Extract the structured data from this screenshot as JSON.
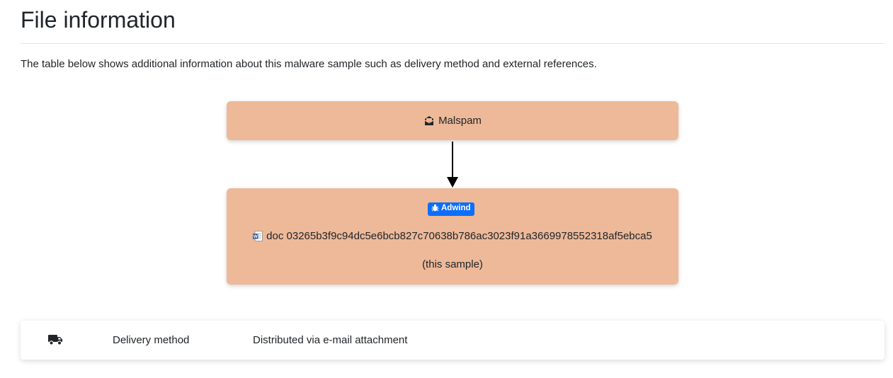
{
  "header": {
    "title": "File information",
    "intro": "The table below shows additional information about this malware sample such as delivery method and external references."
  },
  "flow": {
    "source": {
      "icon": "envelope-open-icon",
      "label": "Malspam"
    },
    "sample": {
      "badge": {
        "icon": "bug-icon",
        "label": "Adwind",
        "color": "#0d6efd"
      },
      "file_icon": "word-document-icon",
      "hash_text": "doc 03265b3f9c94dc5e6bcb827c70638b786ac3023f91a3669978552318af5ebca5",
      "note": "(this sample)"
    },
    "box_color": "#edb999"
  },
  "details": [
    {
      "icon": "truck-icon",
      "label": "Delivery method",
      "value": "Distributed via e-mail attachment"
    }
  ]
}
